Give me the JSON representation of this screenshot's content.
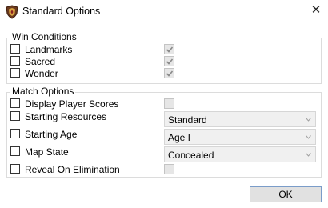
{
  "window": {
    "title": "Standard Options",
    "app_icon": "civ-shield-icon",
    "close_glyph": "✕"
  },
  "win_conditions": {
    "legend": "Win Conditions",
    "items": [
      {
        "label": "Landmarks",
        "checked": false,
        "secondary_checked": true
      },
      {
        "label": "Sacred",
        "checked": false,
        "secondary_checked": true
      },
      {
        "label": "Wonder",
        "checked": false,
        "secondary_checked": true
      }
    ]
  },
  "match_options": {
    "legend": "Match Options",
    "display_player_scores": {
      "label": "Display Player Scores",
      "checked": false,
      "secondary_checked": false
    },
    "starting_resources": {
      "label": "Starting Resources",
      "checked": false,
      "value": "Standard"
    },
    "starting_age": {
      "label": "Starting Age",
      "checked": false,
      "value": "Age I"
    },
    "map_state": {
      "label": "Map State",
      "checked": false,
      "value": "Concealed"
    },
    "reveal_on_elimination": {
      "label": "Reveal On Elimination",
      "checked": false,
      "secondary_checked": false
    }
  },
  "footer": {
    "ok_label": "OK"
  },
  "colors": {
    "disabled_fill": "#e6e6e6",
    "disabled_border": "#c4c4c4",
    "check_mark": "#8a8a8a",
    "ok_border": "#7a9cc9"
  }
}
